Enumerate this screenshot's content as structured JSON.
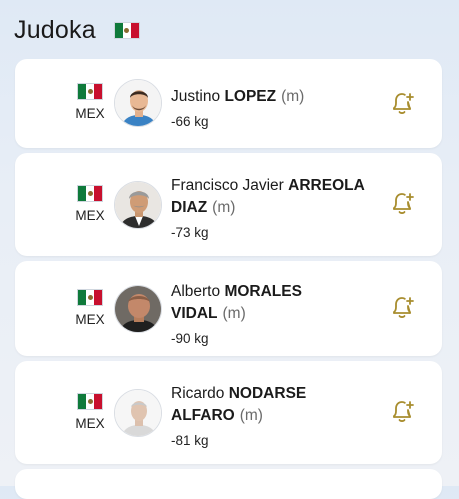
{
  "header": {
    "title": "Judoka",
    "flag_icon": "mexico-flag-icon"
  },
  "colors": {
    "bell": "#a88d2e",
    "flag_green": "#0f7a3b",
    "flag_red": "#c8102e"
  },
  "athletes": [
    {
      "first": "Justino",
      "last": "LOPEZ",
      "gender": "(m)",
      "weight": "-66 kg",
      "country": "MEX"
    },
    {
      "first": "Francisco Javier",
      "last": "ARREOLA DIAZ",
      "gender": "(m)",
      "weight": "-73 kg",
      "country": "MEX"
    },
    {
      "first": "Alberto",
      "last": "MORALES VIDAL",
      "gender": "(m)",
      "weight": "-90 kg",
      "country": "MEX"
    },
    {
      "first": "Ricardo",
      "last": "NODARSE ALFARO",
      "gender": "(m)",
      "weight": "-81 kg",
      "country": "MEX"
    }
  ]
}
